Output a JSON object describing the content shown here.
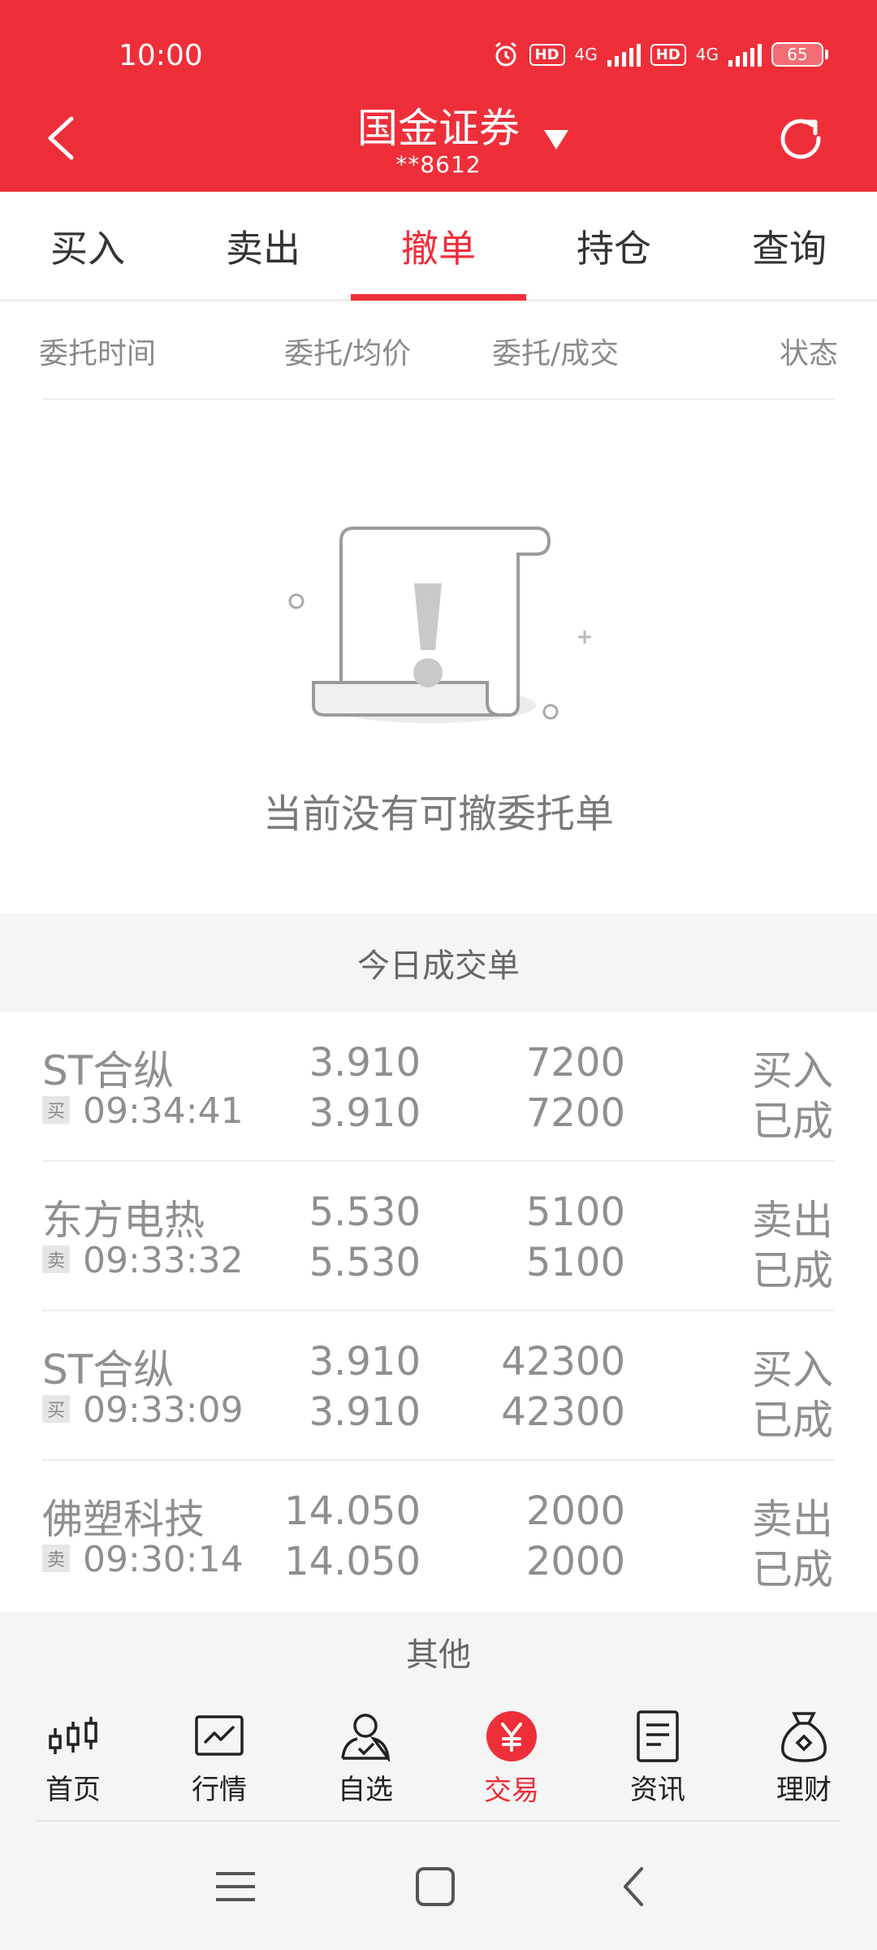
{
  "status_bar": {
    "time": "10:00",
    "hd1": "HD",
    "net1": "4G",
    "hd2": "HD",
    "net2": "4G",
    "battery": "65"
  },
  "header": {
    "title": "国金证券",
    "account": "**8612"
  },
  "tabs": [
    {
      "label": "买入"
    },
    {
      "label": "卖出"
    },
    {
      "label": "撤单"
    },
    {
      "label": "持仓"
    },
    {
      "label": "查询"
    }
  ],
  "active_tab": 2,
  "columns": {
    "time": "委托时间",
    "price": "委托/均价",
    "qty": "委托/成交",
    "status": "状态"
  },
  "empty_state": {
    "text": "当前没有可撤委托单"
  },
  "today_section": {
    "title": "今日成交单"
  },
  "deals": [
    {
      "name": "ST合纵",
      "side": "买",
      "time": "09:34:41",
      "order_price": "3.910",
      "avg_price": "3.910",
      "order_qty": "7200",
      "deal_qty": "7200",
      "action": "买入",
      "status": "已成"
    },
    {
      "name": "东方电热",
      "side": "卖",
      "time": "09:33:32",
      "order_price": "5.530",
      "avg_price": "5.530",
      "order_qty": "5100",
      "deal_qty": "5100",
      "action": "卖出",
      "status": "已成"
    },
    {
      "name": "ST合纵",
      "side": "买",
      "time": "09:33:09",
      "order_price": "3.910",
      "avg_price": "3.910",
      "order_qty": "42300",
      "deal_qty": "42300",
      "action": "买入",
      "status": "已成"
    },
    {
      "name": "佛塑科技",
      "side": "卖",
      "time": "09:30:14",
      "order_price": "14.050",
      "avg_price": "14.050",
      "order_qty": "2000",
      "deal_qty": "2000",
      "action": "卖出",
      "status": "已成"
    }
  ],
  "other_section": {
    "title": "其他"
  },
  "bottom_nav": [
    {
      "label": "首页",
      "icon": "candlestick-icon"
    },
    {
      "label": "行情",
      "icon": "chart-icon"
    },
    {
      "label": "自选",
      "icon": "person-icon"
    },
    {
      "label": "交易",
      "icon": "yuan-icon"
    },
    {
      "label": "资讯",
      "icon": "document-icon"
    },
    {
      "label": "理财",
      "icon": "money-bag-icon"
    }
  ],
  "colors": {
    "brand": "#ee2f3a",
    "muted_text": "#8f8f8f",
    "background": "#f5f5f5"
  }
}
